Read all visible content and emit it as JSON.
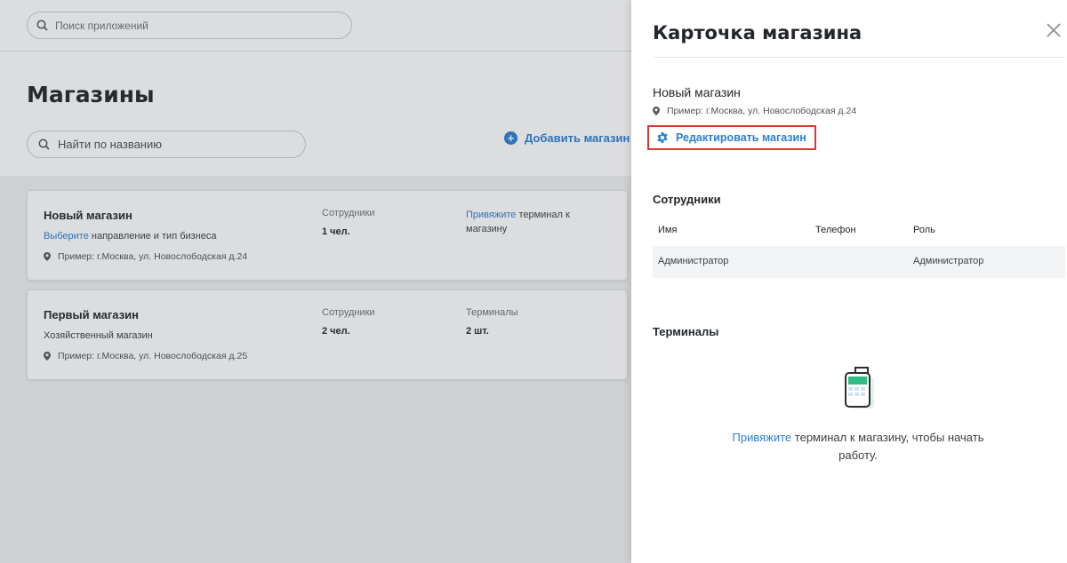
{
  "app_search": {
    "placeholder": "Поиск приложений"
  },
  "page": {
    "title": "Магазины",
    "search_placeholder": "Найти по названию",
    "add_store_label": "Добавить магазин"
  },
  "stores": [
    {
      "name": "Новый магазин",
      "choose_link": "Выберите",
      "choose_rest": " направление и тип бизнеса",
      "address": "Пример: г.Москва, ул. Новослободская д.24",
      "employees_label": "Сотрудники",
      "employees_value": "1 чел.",
      "bind_link": "Привяжите",
      "bind_rest": " терминал к магазину"
    },
    {
      "name": "Первый магазин",
      "category": "Хозяйственный магазин",
      "address": "Пример: г.Москва, ул. Новослободская д.25",
      "employees_label": "Сотрудники",
      "employees_value": "2 чел.",
      "terminals_label": "Терминалы",
      "terminals_value": "2 шт."
    }
  ],
  "panel": {
    "title": "Карточка магазина",
    "shop_name": "Новый магазин",
    "shop_address": "Пример: г.Москва, ул. Новослободская д.24",
    "edit_label": "Редактировать магазин",
    "employees_title": "Сотрудники",
    "table_headers": [
      "Имя",
      "Телефон",
      "Роль"
    ],
    "employees": [
      {
        "name": "Администратор",
        "phone": "",
        "role": "Администратор"
      }
    ],
    "terminals_title": "Терминалы",
    "empty_link": "Привяжите",
    "empty_rest": " терминал к магазину, чтобы начать работу."
  },
  "colors": {
    "accent": "#2a7fd4",
    "highlight_border": "#d9372c",
    "terminal_green": "#2ebd82"
  }
}
